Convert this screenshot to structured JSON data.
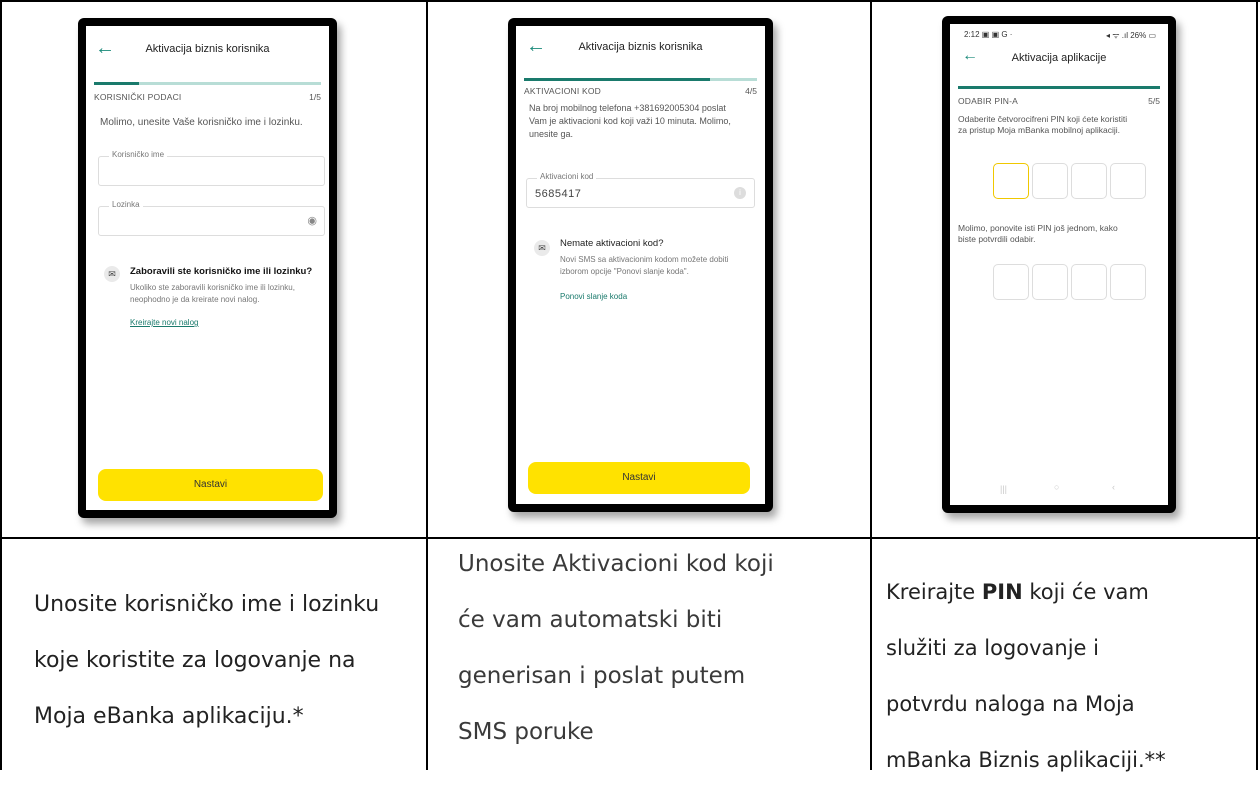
{
  "panels": [
    {
      "title": "Aktivacija biznis korisnika",
      "step_label": "KORISNIČKI PODACI",
      "step_count": "1/5",
      "instruction": "Molimo, unesite Vaše korisničko ime i lozinku.",
      "username_label": "Korisničko ime",
      "password_label": "Lozinka",
      "help_title": "Zaboravili ste korisničko ime ili lozinku?",
      "help_text_1": "Ukoliko ste zaboravili korisničko ime ili lozinku,",
      "help_text_2": "neophodno je da kreirate novi nalog.",
      "help_link": "Kreirajte novi nalog",
      "button": "Nastavi",
      "progress": 0.2
    },
    {
      "title": "Aktivacija biznis korisnika",
      "step_label": "AKTIVACIONI KOD",
      "step_count": "4/5",
      "instruction_1": "Na broj mobilnog telefona +381692005304 poslat",
      "instruction_2": "Vam je aktivacioni kod koji važi 10 minuta. Molimo,",
      "instruction_3": "unesite ga.",
      "code_label": "Aktivacioni kod",
      "code_value": "5685417",
      "help_title": "Nemate aktivacioni kod?",
      "help_text_1": "Novi SMS sa aktivacionim kodom možete dobiti",
      "help_text_2": "izborom opcije \"Ponovi slanje koda\".",
      "help_link": "Ponovi slanje koda",
      "button": "Nastavi",
      "progress": 0.8
    },
    {
      "status_time": "2:12",
      "status_right": "26%",
      "title": "Aktivacija aplikacije",
      "step_label": "ODABIR PIN-A",
      "step_count": "5/5",
      "instruction_1": "Odaberite četvorocifreni PIN koji ćete koristiti",
      "instruction_2": "za pristup Moja mBanka mobilnoj aplikaciji.",
      "repeat_1": "Molimo, ponovite isti PIN još jednom, kako",
      "repeat_2": "biste potvrdili odabir.",
      "progress": 1.0
    }
  ],
  "captions": {
    "c1_line1": "Unosite korisničko ime i lozinku",
    "c1_line2": "koje koristite za logovanje na",
    "c1_line3": "Moja eBanka aplikaciju.*",
    "c2_line1": "Unosite Aktivacioni kod koji",
    "c2_line2": "će vam automatski biti",
    "c2_line3": "generisan i poslat putem",
    "c2_line4": "SMS poruke",
    "c3_line1_a": "Kreirajte ",
    "c3_line1_b": "PIN",
    "c3_line1_c": " koji će vam",
    "c3_line2": "služiti za logovanje i",
    "c3_line3": "potvrdu naloga na Moja",
    "c3_line4": "mBanka Biznis aplikaciji.**"
  }
}
